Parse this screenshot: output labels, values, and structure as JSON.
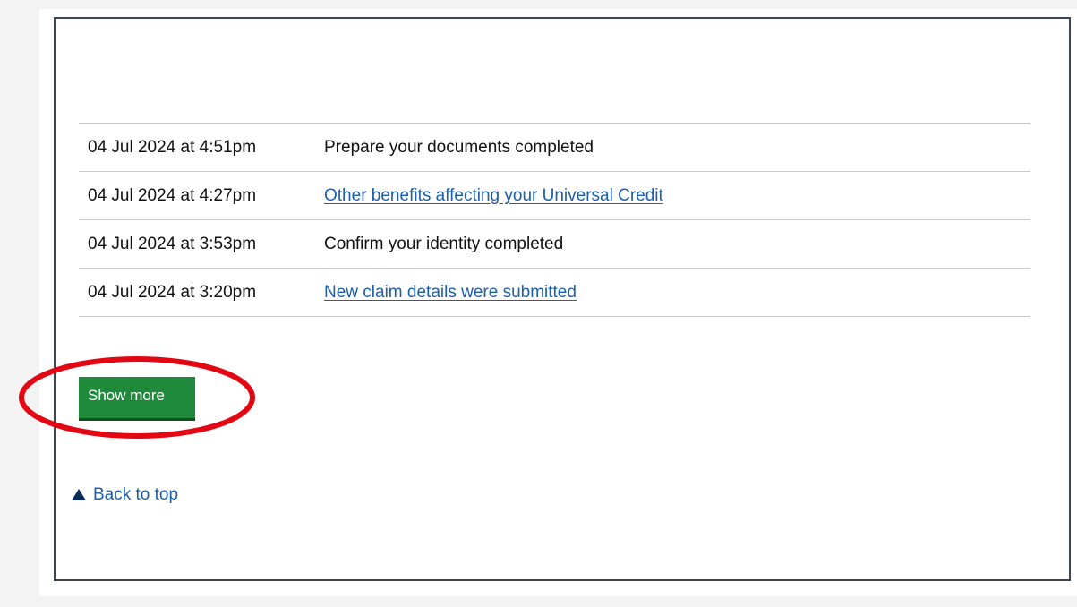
{
  "timeline": {
    "rows": [
      {
        "date": "04 Jul 2024 at 4:51pm",
        "event": "Prepare your documents completed",
        "is_link": false
      },
      {
        "date": "04 Jul 2024 at 4:27pm",
        "event": "Other benefits affecting your Universal Credit",
        "is_link": true
      },
      {
        "date": "04 Jul 2024 at 3:53pm",
        "event": "Confirm your identity completed",
        "is_link": false
      },
      {
        "date": "04 Jul 2024 at 3:20pm",
        "event": "New claim details were submitted",
        "is_link": true
      }
    ]
  },
  "show_more": {
    "label": "Show more",
    "color": "#1f8a3c"
  },
  "highlight": {
    "color": "#e30613",
    "icon": "red-ellipse-annotation"
  },
  "back_to_top": {
    "label": "Back to top",
    "icon": "triangle-up-icon"
  },
  "colors": {
    "link": "#1d5fa8",
    "text": "#111111",
    "frame_border": "#3b4654"
  }
}
